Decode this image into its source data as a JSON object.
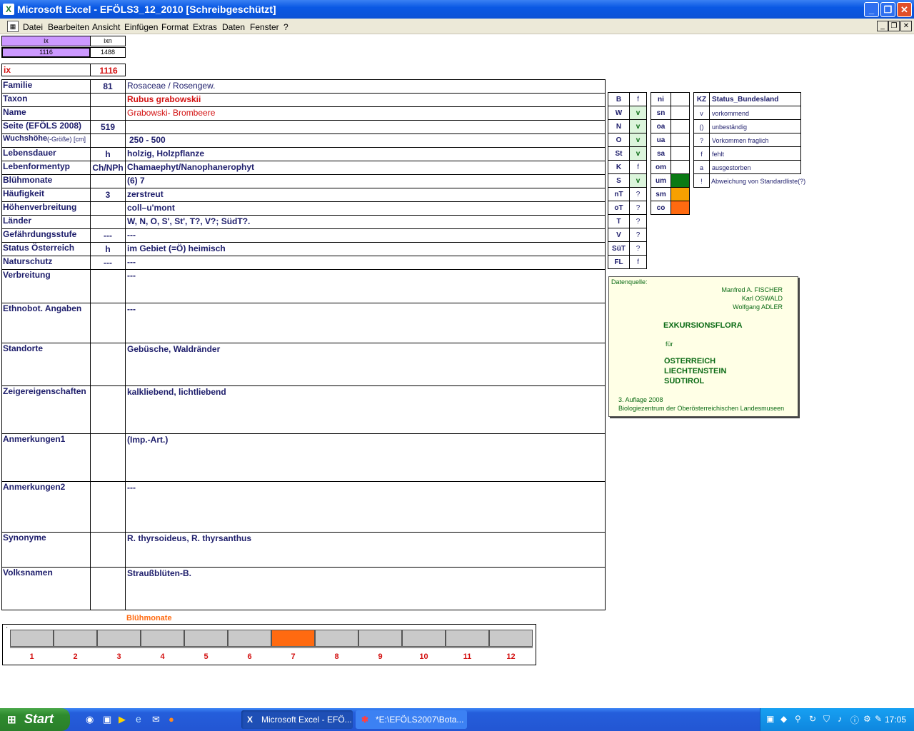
{
  "window": {
    "title": "Microsoft Excel - EFÖLS3_12_2010  [Schreibgeschützt]",
    "controls": {
      "minimize": "_",
      "restore": "❐",
      "close": "✕"
    }
  },
  "menu": [
    "Datei",
    "Bearbeiten",
    "Ansicht",
    "Einfügen",
    "Format",
    "Extras",
    "Daten",
    "Fenster",
    "?"
  ],
  "index_cells": {
    "ix_head": "ix",
    "ixn_head": "ixn",
    "ix_val": "1116",
    "ixn_val": "1488"
  },
  "ix": {
    "label": "ix",
    "value": "1116"
  },
  "rows": [
    {
      "label": "Familie",
      "mid": "81",
      "value": "Rosaceae  /  Rosengew."
    },
    {
      "label": "Taxon",
      "mid": "",
      "value": "Rubus grabowskii"
    },
    {
      "label": "Name",
      "mid": "",
      "value": "Grabowski- Brombeere"
    },
    {
      "label": "Seite (EFÖLS 2008)",
      "mid": "519",
      "value": ""
    },
    {
      "label": "Wuchshöhe",
      "label_suffix": "(-Größe) [cm]",
      "mid": "",
      "value": "250 - 500"
    },
    {
      "label": "Lebensdauer",
      "mid": "h",
      "value": "holzig, Holzpflanze"
    },
    {
      "label": "Lebenformentyp",
      "mid": "Ch/NPh",
      "value": "Chamaephyt/Nanophanerophyt"
    },
    {
      "label": "Blühmonate",
      "mid": "",
      "value": "(6) 7"
    },
    {
      "label": "Häufigkeit",
      "mid": "3",
      "value": "zerstreut"
    },
    {
      "label": "Höhenverbreitung",
      "mid": "",
      "value": "coll–u'mont"
    },
    {
      "label": "Länder",
      "mid": "",
      "value": "W, N, O, S', St', T?, V?; SüdT?."
    },
    {
      "label": "Gefährdungsstufe",
      "mid": "---",
      "value": "---"
    },
    {
      "label": "Status Österreich",
      "mid": "h",
      "value": "im Gebiet (=Ö) heimisch"
    },
    {
      "label": "Naturschutz",
      "mid": "---",
      "value": "---"
    },
    {
      "label": "Verbreitung",
      "mid": "",
      "value": "---"
    },
    {
      "label": "Ethnobot. Angaben",
      "mid": "",
      "value": "---"
    },
    {
      "label": "Standorte",
      "mid": "",
      "value": "Gebüsche, Waldränder"
    },
    {
      "label": "Zeigereigenschaften",
      "mid": "",
      "value": "kalkliebend, lichtliebend"
    },
    {
      "label": "Anmerkungen1",
      "mid": "",
      "value": "(Imp.-Art.)"
    },
    {
      "label": "Anmerkungen2",
      "mid": "",
      "value": "---"
    },
    {
      "label": "Synonyme",
      "mid": "",
      "value": "R. thyrsoideus, R. thyrsanthus"
    },
    {
      "label": "Volksnamen",
      "mid": "",
      "value": "Straußblüten-B."
    }
  ],
  "bundesland": [
    {
      "code": "B",
      "flag": "f"
    },
    {
      "code": "W",
      "flag": "v"
    },
    {
      "code": "N",
      "flag": "v"
    },
    {
      "code": "O",
      "flag": "v"
    },
    {
      "code": "St",
      "flag": "v"
    },
    {
      "code": "K",
      "flag": "f"
    },
    {
      "code": "S",
      "flag": "v"
    },
    {
      "code": "nT",
      "flag": "?"
    },
    {
      "code": "oT",
      "flag": "?"
    },
    {
      "code": "T",
      "flag": "?"
    },
    {
      "code": "V",
      "flag": "?"
    },
    {
      "code": "SüT",
      "flag": "?"
    },
    {
      "code": "FL",
      "flag": "f"
    }
  ],
  "hoehenstufen": [
    {
      "code": "ni",
      "fill": ""
    },
    {
      "code": "sn",
      "fill": ""
    },
    {
      "code": "oa",
      "fill": ""
    },
    {
      "code": "ua",
      "fill": ""
    },
    {
      "code": "sa",
      "fill": ""
    },
    {
      "code": "om",
      "fill": ""
    },
    {
      "code": "um",
      "fill": "#0a7a14"
    },
    {
      "code": "sm",
      "fill": "#f7a000"
    },
    {
      "code": "co",
      "fill": "#ff6a10"
    }
  ],
  "legend": {
    "kz_head": "KZ",
    "status_head": "Status_Bundesland",
    "items": [
      {
        "kz": "v",
        "text": "vorkommend"
      },
      {
        "kz": "()",
        "text": "unbeständig"
      },
      {
        "kz": "?",
        "text": "Vorkommen fraglich"
      },
      {
        "kz": "f",
        "text": "fehlt"
      },
      {
        "kz": "a",
        "text": "ausgestorben"
      },
      {
        "kz": "!",
        "text": "Abweichung von Standardliste(?)"
      }
    ]
  },
  "source": {
    "label": "Datenquelle:",
    "authors": [
      "Manfred A. FISCHER",
      "Karl OSWALD",
      "Wolfgang ADLER"
    ],
    "title": "EXKURSIONSFLORA",
    "fuer": "für",
    "countries": [
      "ÖSTERREICH",
      "LIECHTENSTEIN",
      "SÜDTIROL"
    ],
    "edition": "3. Auflage 2008",
    "publisher": "Biologiezentrum der Oberösterreichischen Landesmuseen"
  },
  "bloom": {
    "title": "Blühmonate",
    "months": [
      "1",
      "2",
      "3",
      "4",
      "5",
      "6",
      "7",
      "8",
      "9",
      "10",
      "11",
      "12"
    ],
    "active": [
      false,
      false,
      false,
      false,
      false,
      false,
      true,
      false,
      false,
      false,
      false,
      false
    ],
    "colors": {
      "active": "#ff6a10",
      "inactive": "#c9c9c9"
    }
  },
  "taskbar": {
    "start": "Start",
    "tasks": [
      "Microsoft Excel - EFÖ...",
      "*E:\\EFÖLS2007\\Bota..."
    ],
    "clock": "17:05"
  }
}
